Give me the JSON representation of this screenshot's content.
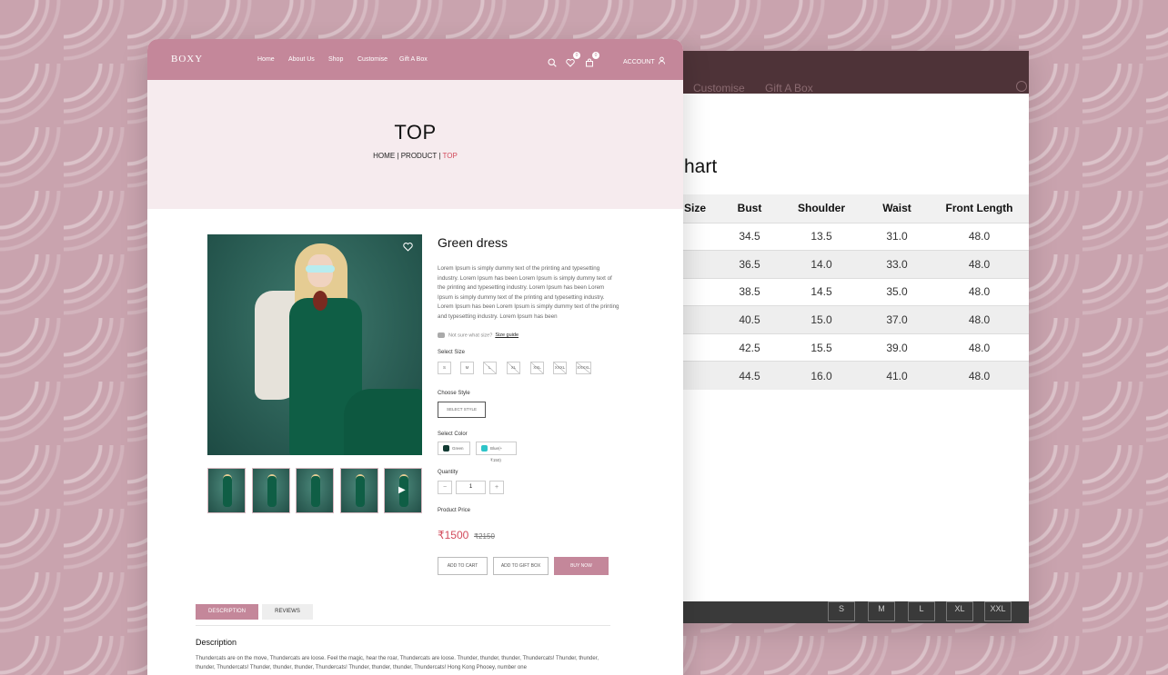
{
  "back": {
    "nav_links": [
      "Customise",
      "Gift A Box"
    ],
    "chart_title": "hart",
    "table": {
      "headers": [
        "Size",
        "Bust",
        "Shoulder",
        "Waist",
        "Front Length"
      ],
      "rows": [
        [
          "",
          "34.5",
          "13.5",
          "31.0",
          "48.0"
        ],
        [
          "",
          "36.5",
          "14.0",
          "33.0",
          "48.0"
        ],
        [
          "",
          "38.5",
          "14.5",
          "35.0",
          "48.0"
        ],
        [
          "",
          "40.5",
          "15.0",
          "37.0",
          "48.0"
        ],
        [
          "",
          "42.5",
          "15.5",
          "39.0",
          "48.0"
        ],
        [
          "",
          "44.5",
          "16.0",
          "41.0",
          "48.0"
        ]
      ]
    },
    "strip_sizes": [
      "S",
      "M",
      "L",
      "XL",
      "XXL"
    ]
  },
  "header": {
    "logo": "BOXY",
    "nav": [
      "Home",
      "About Us",
      "Shop",
      "Customise",
      "Gift A Box"
    ],
    "wishlist_count": "0",
    "cart_count": "0",
    "account_label": "ACCOUNT"
  },
  "hero": {
    "title": "TOP",
    "crumbs": [
      "HOME",
      "PRODUCT",
      "TOP"
    ],
    "sep": "|"
  },
  "product": {
    "name": "Green dress",
    "description": "Lorem Ipsum is simply dummy text of the printing and typesetting industry. Lorem Ipsum has been Lorem Ipsum is simply dummy text of the printing and typesetting industry. Lorem Ipsum has been Lorem Ipsum is simply dummy text of the printing and typesetting industry. Lorem Ipsum has been Lorem Ipsum is simply dummy text of the printing and typesetting industry. Lorem Ipsum has been",
    "size_hint": "Not sure what size?",
    "size_guide": "Size guide",
    "select_size_label": "Select Size",
    "sizes": [
      "S",
      "M",
      "L",
      "XL",
      "XXL",
      "XXXL",
      "XXXXL"
    ],
    "choose_style_label": "Choose Style",
    "style_placeholder": "SELECT STYLE",
    "select_color_label": "Select Color",
    "colors": [
      {
        "name": "Green",
        "hex": "#123b33"
      },
      {
        "name": "Blue(+₹150)",
        "hex": "#2ec4c8"
      }
    ],
    "quantity_label": "Quantity",
    "qty_minus": "−",
    "qty_value": "1",
    "qty_plus": "+",
    "price_label": "Product Price",
    "price": "₹1500",
    "old_price": "₹2150",
    "add_to_cart": "ADD TO CART",
    "add_to_gift_box": "ADD TO GIFT BOX",
    "buy_now": "BUY NOW"
  },
  "tabs": {
    "description": "DESCRIPTION",
    "reviews": "REVIEWS"
  },
  "description": {
    "heading": "Description",
    "text": "Thundercats are on the move, Thundercats are loose. Feel the magic, hear the roar, Thundercats are loose. Thunder, thunder, thunder, Thundercats! Thunder, thunder, thunder, Thundercats! Thunder, thunder, thunder, Thundercats! Thunder, thunder, thunder, Thundercats! Hong Kong Phooey, number one"
  },
  "colors": {
    "brand": "#c4879a",
    "hero_bg": "#f6ebee",
    "accent_red": "#d24a5b",
    "back_nav": "#4e3338"
  }
}
